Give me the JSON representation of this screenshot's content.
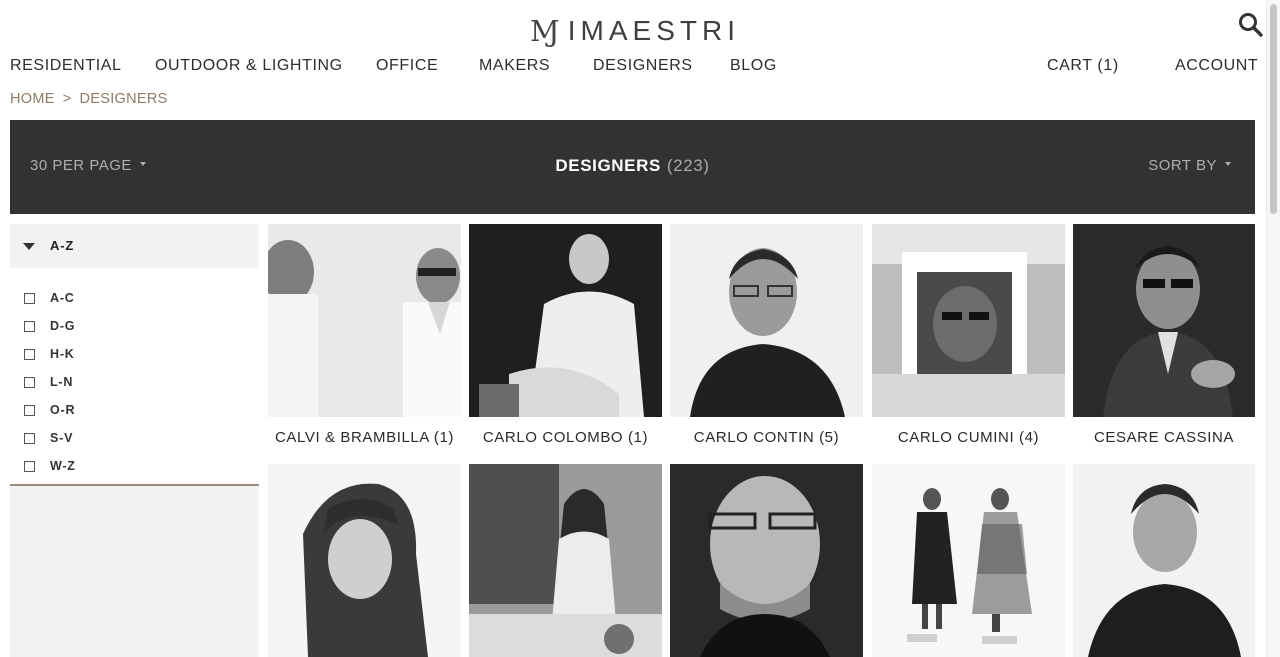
{
  "header": {
    "logo_mark": "Ɱ",
    "logo_text": "IMAESTRI",
    "search_icon": "search-icon"
  },
  "nav": {
    "items": [
      "RESIDENTIAL",
      "OUTDOOR & LIGHTING",
      "OFFICE",
      "MAKERS",
      "DESIGNERS",
      "BLOG"
    ],
    "cart": "CART (1)",
    "account": "ACCOUNT"
  },
  "breadcrumb": {
    "home": "HOME",
    "separator": ">",
    "current": "DESIGNERS"
  },
  "toolbar": {
    "per_page": "30 PER PAGE",
    "title": "DESIGNERS",
    "count": "(223)",
    "sort": "SORT BY"
  },
  "filter": {
    "heading": "A-Z",
    "options": [
      "A-C",
      "D-G",
      "H-K",
      "L-N",
      "O-R",
      "S-V",
      "W-Z"
    ]
  },
  "designers": [
    {
      "name": "CALVI & BRAMBILLA (1)"
    },
    {
      "name": "CARLO COLOMBO (1)"
    },
    {
      "name": "CARLO CONTIN (5)"
    },
    {
      "name": "CARLO CUMINI (4)"
    },
    {
      "name": "CESARE CASSINA"
    },
    {
      "name": ""
    },
    {
      "name": ""
    },
    {
      "name": ""
    },
    {
      "name": ""
    },
    {
      "name": ""
    }
  ],
  "colors": {
    "accent": "#8e7a66",
    "toolbar_bg": "#323232",
    "sidebar_bg": "#f2f2f2"
  }
}
